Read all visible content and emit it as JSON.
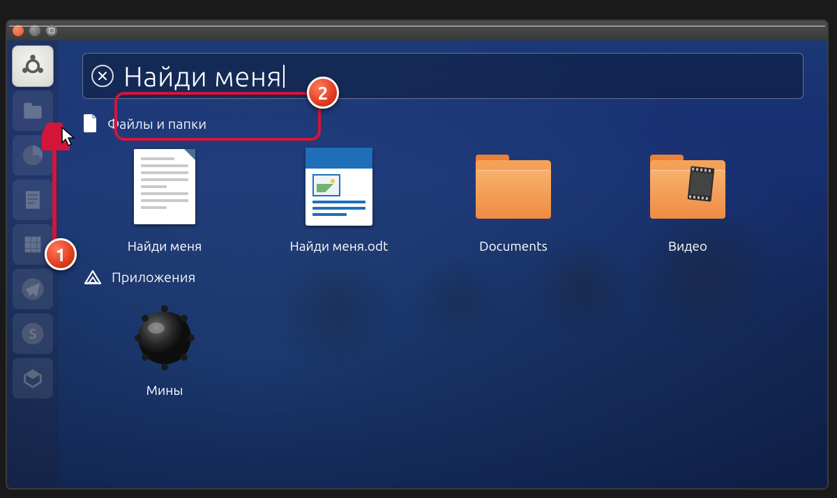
{
  "search": {
    "value": "Найди меня"
  },
  "sections": {
    "files": {
      "title": "Файлы и папки"
    },
    "apps": {
      "title": "Приложения"
    }
  },
  "results": {
    "files": [
      {
        "label": "Найди меня",
        "icon": "text-document"
      },
      {
        "label": "Найди меня.odt",
        "icon": "odt-document"
      },
      {
        "label": "Documents",
        "icon": "folder"
      },
      {
        "label": "Видео",
        "icon": "folder-video"
      }
    ],
    "apps": [
      {
        "label": "Мины",
        "icon": "mines"
      }
    ]
  },
  "launcher": [
    {
      "name": "dash-home",
      "active": true
    },
    {
      "name": "files"
    },
    {
      "name": "firefox"
    },
    {
      "name": "writer"
    },
    {
      "name": "calc"
    },
    {
      "name": "telegram"
    },
    {
      "name": "skype"
    },
    {
      "name": "software"
    }
  ],
  "callouts": {
    "one": "1",
    "two": "2"
  }
}
